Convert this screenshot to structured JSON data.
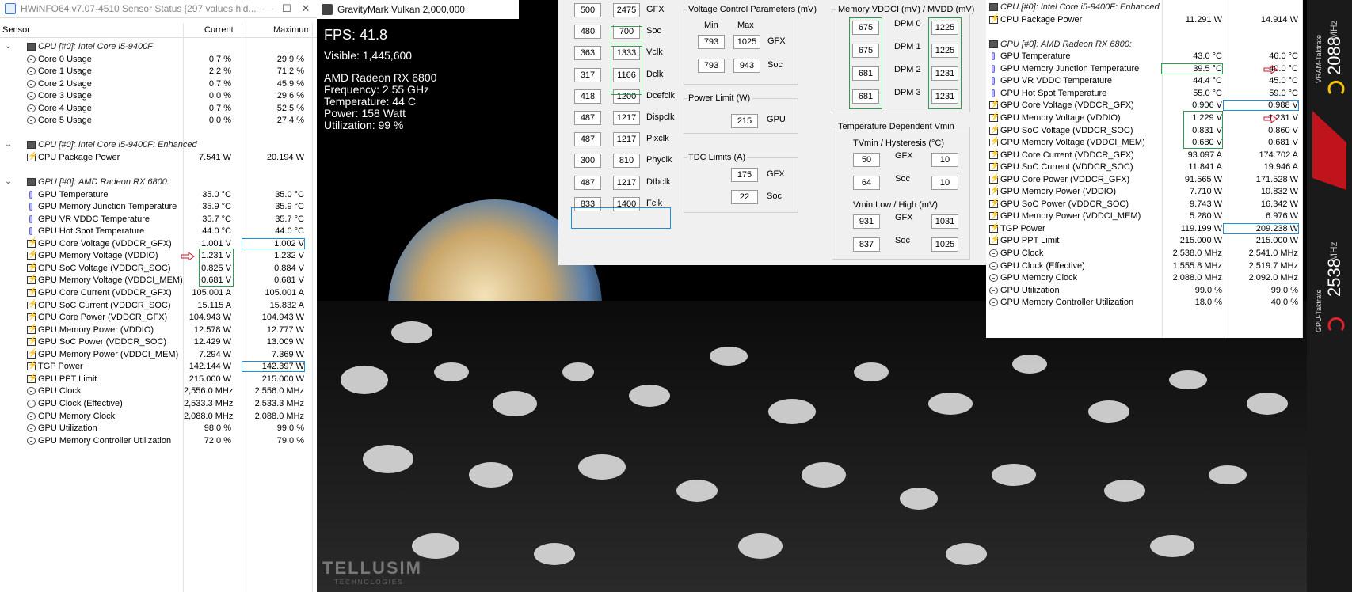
{
  "hwinfo": {
    "title": "HWiNFO64 v7.07-4510 Sensor Status [297 values hid...",
    "window_buttons": [
      "—",
      "☐",
      "✕"
    ],
    "columns": [
      "Sensor",
      "Current",
      "Maximum"
    ],
    "rows": [
      {
        "type": "group",
        "label": "CPU [#0]: Intel Core i5-9400F"
      },
      {
        "type": "clock",
        "label": "Core 0 Usage",
        "cur": "0.7 %",
        "max": "29.9 %"
      },
      {
        "type": "clock",
        "label": "Core 1 Usage",
        "cur": "2.2 %",
        "max": "71.2 %"
      },
      {
        "type": "clock",
        "label": "Core 2 Usage",
        "cur": "0.7 %",
        "max": "45.9 %"
      },
      {
        "type": "clock",
        "label": "Core 3 Usage",
        "cur": "0.0 %",
        "max": "29.6 %"
      },
      {
        "type": "clock",
        "label": "Core 4 Usage",
        "cur": "0.7 %",
        "max": "52.5 %"
      },
      {
        "type": "clock",
        "label": "Core 5 Usage",
        "cur": "0.0 %",
        "max": "27.4 %"
      },
      {
        "type": "blank"
      },
      {
        "type": "group",
        "label": "CPU [#0]: Intel Core i5-9400F: Enhanced"
      },
      {
        "type": "bolt",
        "label": "CPU Package Power",
        "cur": "7.541 W",
        "max": "20.194 W"
      },
      {
        "type": "blank"
      },
      {
        "type": "group",
        "label": "GPU [#0]: AMD Radeon RX 6800:"
      },
      {
        "type": "therm",
        "label": "GPU Temperature",
        "cur": "35.0 °C",
        "max": "35.0 °C"
      },
      {
        "type": "therm",
        "label": "GPU Memory Junction Temperature",
        "cur": "35.9 °C",
        "max": "35.9 °C"
      },
      {
        "type": "therm",
        "label": "GPU VR VDDC Temperature",
        "cur": "35.7 °C",
        "max": "35.7 °C"
      },
      {
        "type": "therm",
        "label": "GPU Hot Spot Temperature",
        "cur": "44.0 °C",
        "max": "44.0 °C"
      },
      {
        "type": "bolt",
        "label": "GPU Core Voltage (VDDCR_GFX)",
        "cur": "1.001 V",
        "max": "1.002 V",
        "boxmax": "blue"
      },
      {
        "type": "bolt",
        "label": "GPU Memory Voltage (VDDIO)",
        "cur": "1.231 V",
        "max": "1.232 V",
        "arrow": true
      },
      {
        "type": "bolt",
        "label": "GPU SoC Voltage (VDDCR_SOC)",
        "cur": "0.825 V",
        "max": "0.884 V"
      },
      {
        "type": "bolt",
        "label": "GPU Memory Voltage (VDDCI_MEM)",
        "cur": "0.681 V",
        "max": "0.681 V"
      },
      {
        "type": "bolt",
        "label": "GPU Core Current (VDDCR_GFX)",
        "cur": "105.001 A",
        "max": "105.001 A"
      },
      {
        "type": "bolt",
        "label": "GPU SoC Current (VDDCR_SOC)",
        "cur": "15.115 A",
        "max": "15.832 A"
      },
      {
        "type": "bolt",
        "label": "GPU Core Power (VDDCR_GFX)",
        "cur": "104.943 W",
        "max": "104.943 W"
      },
      {
        "type": "bolt",
        "label": "GPU Memory Power (VDDIO)",
        "cur": "12.578 W",
        "max": "12.777 W"
      },
      {
        "type": "bolt",
        "label": "GPU SoC Power (VDDCR_SOC)",
        "cur": "12.429 W",
        "max": "13.009 W"
      },
      {
        "type": "bolt",
        "label": "GPU Memory Power (VDDCI_MEM)",
        "cur": "7.294 W",
        "max": "7.369 W"
      },
      {
        "type": "bolt",
        "label": "TGP Power",
        "cur": "142.144 W",
        "max": "142.397 W",
        "boxmax": "blue"
      },
      {
        "type": "bolt",
        "label": "GPU PPT Limit",
        "cur": "215.000 W",
        "max": "215.000 W"
      },
      {
        "type": "clock",
        "label": "GPU Clock",
        "cur": "2,556.0 MHz",
        "max": "2,556.0 MHz"
      },
      {
        "type": "clock",
        "label": "GPU Clock (Effective)",
        "cur": "2,533.3 MHz",
        "max": "2,533.3 MHz"
      },
      {
        "type": "clock",
        "label": "GPU Memory Clock",
        "cur": "2,088.0 MHz",
        "max": "2,088.0 MHz"
      },
      {
        "type": "clock",
        "label": "GPU Utilization",
        "cur": "98.0 %",
        "max": "99.0 %"
      },
      {
        "type": "clock",
        "label": "GPU Memory Controller Utilization",
        "cur": "72.0 %",
        "max": "79.0 %"
      }
    ]
  },
  "gravitymark": {
    "title": "GravityMark Vulkan 2,000,000",
    "fps": "FPS: 41.8",
    "visible": "Visible: 1,445,600",
    "gpu": "AMD Radeon RX 6800",
    "frequency": "Frequency: 2.55 GHz",
    "temperature": "Temperature: 44 C",
    "power": "Power: 158 Watt",
    "utilization": "Utilization: 99 %",
    "watermark": "TELLUSIM",
    "watermark_sub": "TECHNOLOGIES"
  },
  "mpt": {
    "clocks": [
      {
        "a": "500",
        "b": "2475",
        "label": "GFX"
      },
      {
        "a": "480",
        "b": "700",
        "label": "Soc"
      },
      {
        "a": "363",
        "b": "1333",
        "label": "Vclk"
      },
      {
        "a": "317",
        "b": "1166",
        "label": "Dclk"
      },
      {
        "a": "418",
        "b": "1200",
        "label": "Dcefclk"
      },
      {
        "a": "487",
        "b": "1217",
        "label": "Dispclk"
      },
      {
        "a": "487",
        "b": "1217",
        "label": "Pixclk"
      },
      {
        "a": "300",
        "b": "810",
        "label": "Phyclk"
      },
      {
        "a": "487",
        "b": "1217",
        "label": "Dtbclk"
      },
      {
        "a": "833",
        "b": "1400",
        "label": "Fclk"
      }
    ],
    "voltage": {
      "title": "Voltage Control Parameters (mV)",
      "min": "Min",
      "max": "Max",
      "rows": [
        {
          "min": "793",
          "max": "1025",
          "label": "GFX"
        },
        {
          "min": "793",
          "max": "943",
          "label": "Soc"
        }
      ]
    },
    "power_limit": {
      "title": "Power Limit (W)",
      "value": "215",
      "label": "GPU"
    },
    "tdc": {
      "title": "TDC Limits (A)",
      "rows": [
        {
          "value": "175",
          "label": "GFX"
        },
        {
          "value": "22",
          "label": "Soc"
        }
      ]
    },
    "memory": {
      "title": "Memory VDDCI (mV) / MVDD (mV)",
      "rows": [
        {
          "a": "675",
          "label": "DPM 0",
          "b": "1225"
        },
        {
          "a": "675",
          "label": "DPM 1",
          "b": "1225"
        },
        {
          "a": "681",
          "label": "DPM 2",
          "b": "1231"
        },
        {
          "a": "681",
          "label": "DPM 3",
          "b": "1231"
        }
      ]
    },
    "tdv": {
      "title": "Temperature Dependent Vmin",
      "sub1": "TVmin / Hysteresis (°C)",
      "rows1": [
        {
          "a": "50",
          "label": "GFX",
          "b": "10"
        },
        {
          "a": "64",
          "label": "Soc",
          "b": "10"
        }
      ],
      "sub2": "Vmin Low / High (mV)",
      "rows2": [
        {
          "a": "931",
          "label": "GFX",
          "b": "1031"
        },
        {
          "a": "837",
          "label": "Soc",
          "b": "1025"
        }
      ]
    }
  },
  "hwinfo2": {
    "rows": [
      {
        "type": "group",
        "label": "CPU [#0]: Intel Core i5-9400F: Enhanced"
      },
      {
        "type": "bolt",
        "label": "CPU Package Power",
        "cur": "11.291 W",
        "max": "14.914 W"
      },
      {
        "type": "blank"
      },
      {
        "type": "group",
        "label": "GPU [#0]: AMD Radeon RX 6800:"
      },
      {
        "type": "therm",
        "label": "GPU Temperature",
        "cur": "43.0 °C",
        "max": "46.0 °C"
      },
      {
        "type": "therm",
        "label": "GPU Memory Junction Temperature",
        "cur": "39.5 °C",
        "max": "40.0 °C",
        "arrow": true,
        "boxcur": "green"
      },
      {
        "type": "therm",
        "label": "GPU VR VDDC Temperature",
        "cur": "44.4 °C",
        "max": "45.0 °C"
      },
      {
        "type": "therm",
        "label": "GPU Hot Spot Temperature",
        "cur": "55.0 °C",
        "max": "59.0 °C"
      },
      {
        "type": "bolt",
        "label": "GPU Core Voltage (VDDCR_GFX)",
        "cur": "0.906 V",
        "max": "0.988 V",
        "boxmax": "blue"
      },
      {
        "type": "bolt",
        "label": "GPU Memory Voltage (VDDIO)",
        "cur": "1.229 V",
        "max": "1.231 V",
        "arrow": true
      },
      {
        "type": "bolt",
        "label": "GPU SoC Voltage (VDDCR_SOC)",
        "cur": "0.831 V",
        "max": "0.860 V"
      },
      {
        "type": "bolt",
        "label": "GPU Memory Voltage (VDDCI_MEM)",
        "cur": "0.680 V",
        "max": "0.681 V"
      },
      {
        "type": "bolt",
        "label": "GPU Core Current (VDDCR_GFX)",
        "cur": "93.097 A",
        "max": "174.702 A"
      },
      {
        "type": "bolt",
        "label": "GPU SoC Current (VDDCR_SOC)",
        "cur": "11.841 A",
        "max": "19.946 A"
      },
      {
        "type": "bolt",
        "label": "GPU Core Power (VDDCR_GFX)",
        "cur": "91.565 W",
        "max": "171.528 W"
      },
      {
        "type": "bolt",
        "label": "GPU Memory Power (VDDIO)",
        "cur": "7.710 W",
        "max": "10.832 W"
      },
      {
        "type": "bolt",
        "label": "GPU SoC Power (VDDCR_SOC)",
        "cur": "9.743 W",
        "max": "16.342 W"
      },
      {
        "type": "bolt",
        "label": "GPU Memory Power (VDDCI_MEM)",
        "cur": "5.280 W",
        "max": "6.976 W"
      },
      {
        "type": "bolt",
        "label": "TGP Power",
        "cur": "119.199 W",
        "max": "209.238 W",
        "boxmax": "blue"
      },
      {
        "type": "bolt",
        "label": "GPU PPT Limit",
        "cur": "215.000 W",
        "max": "215.000 W"
      },
      {
        "type": "clock",
        "label": "GPU Clock",
        "cur": "2,538.0 MHz",
        "max": "2,541.0 MHz"
      },
      {
        "type": "clock",
        "label": "GPU Clock (Effective)",
        "cur": "1,555.8 MHz",
        "max": "2,519.7 MHz"
      },
      {
        "type": "clock",
        "label": "GPU Memory Clock",
        "cur": "2,088.0 MHz",
        "max": "2,092.0 MHz"
      },
      {
        "type": "clock",
        "label": "GPU Utilization",
        "cur": "99.0 %",
        "max": "99.0 %"
      },
      {
        "type": "clock",
        "label": "GPU Memory Controller Utilization",
        "cur": "18.0 %",
        "max": "40.0 %"
      }
    ]
  },
  "sidebar": {
    "vram_label": "VRAM-Taktrate",
    "vram_value": "2088",
    "vram_unit": "MHz",
    "gpu_label": "GPU-Taktrate",
    "gpu_value": "2538",
    "gpu_unit": "MHz",
    "accent": "#c0141c"
  }
}
